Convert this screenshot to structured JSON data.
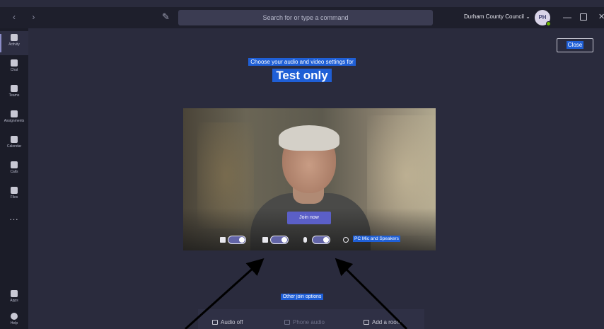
{
  "titlebar": {
    "search_placeholder": "Search for or type a command",
    "org_name": "Durham County Council ⌄",
    "avatar_initials": "PH"
  },
  "appbar": {
    "items": [
      {
        "label": "Activity",
        "icon": "bell-icon"
      },
      {
        "label": "Chat",
        "icon": "chat-icon"
      },
      {
        "label": "Teams",
        "icon": "teams-icon"
      },
      {
        "label": "Assignments",
        "icon": "assignments-icon"
      },
      {
        "label": "Calendar",
        "icon": "calendar-icon"
      },
      {
        "label": "Calls",
        "icon": "phone-icon"
      },
      {
        "label": "Files",
        "icon": "files-icon"
      },
      {
        "label": "Apps",
        "icon": "apps-icon"
      },
      {
        "label": "Help",
        "icon": "help-icon"
      }
    ],
    "more": "..."
  },
  "main": {
    "close_label": "Close",
    "subtitle": "Choose your audio and video settings for",
    "meeting_title": "Test only",
    "join_label": "Join now",
    "device_label": "PC Mic and Speakers",
    "other_join": "Other join options",
    "options": {
      "audio_off": "Audio off",
      "phone_audio": "Phone audio",
      "add_room": "Add a room"
    }
  },
  "colors": {
    "accent": "#5b5fc7",
    "selection": "#1f5fd6",
    "background": "#2a2b3d"
  }
}
